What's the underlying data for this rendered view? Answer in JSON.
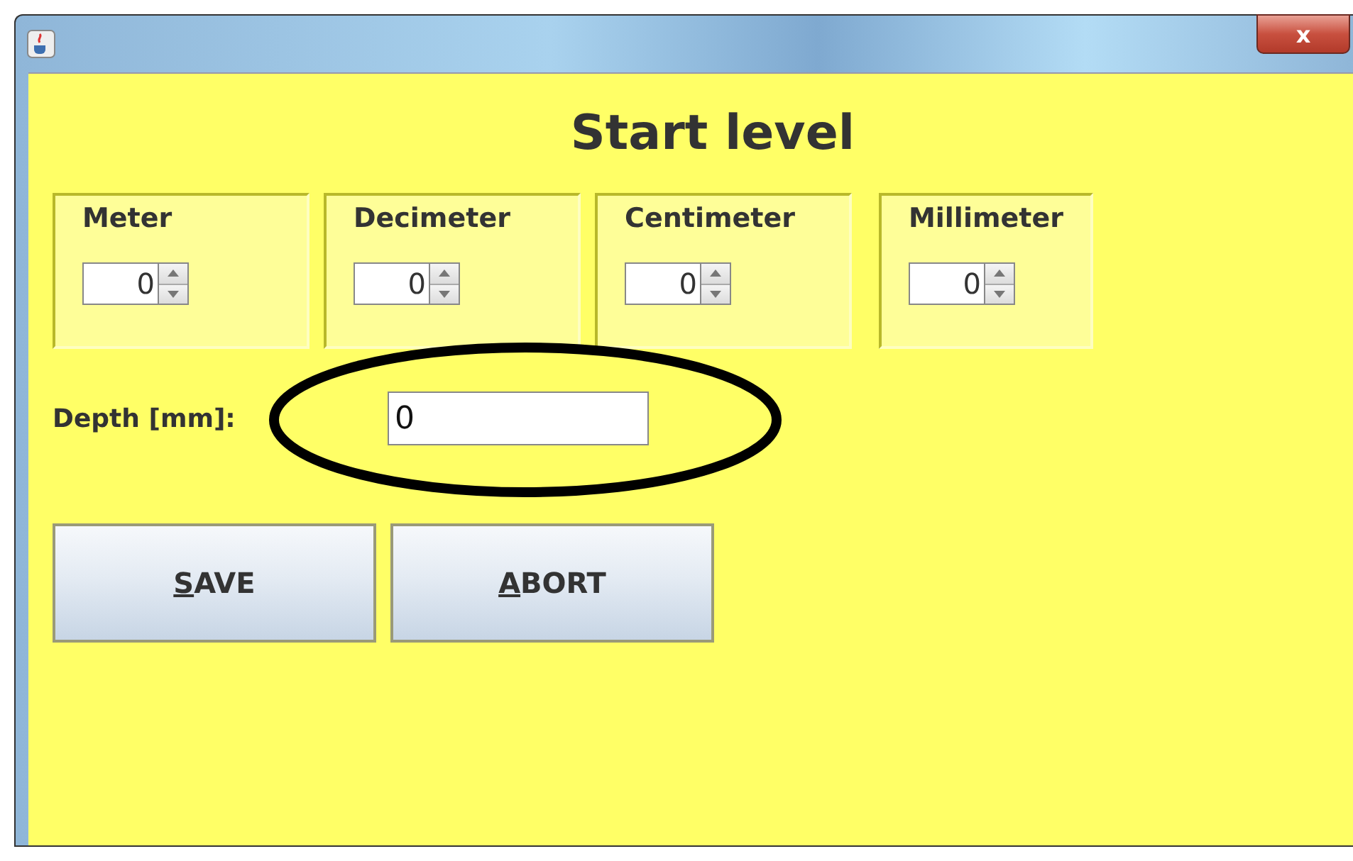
{
  "window": {
    "close_button": "x"
  },
  "title": "Start level",
  "units": [
    {
      "label": "Meter",
      "value": "0"
    },
    {
      "label": "Decimeter",
      "value": "0"
    },
    {
      "label": "Centimeter",
      "value": "0"
    },
    {
      "label": "Millimeter",
      "value": "0"
    }
  ],
  "depth": {
    "label": "Depth [mm]:",
    "value": "0"
  },
  "annotation": {
    "kind": "ellipse"
  },
  "buttons": [
    {
      "mnemonic": "S",
      "label": "AVE"
    },
    {
      "mnemonic": "A",
      "label": "BORT"
    }
  ]
}
